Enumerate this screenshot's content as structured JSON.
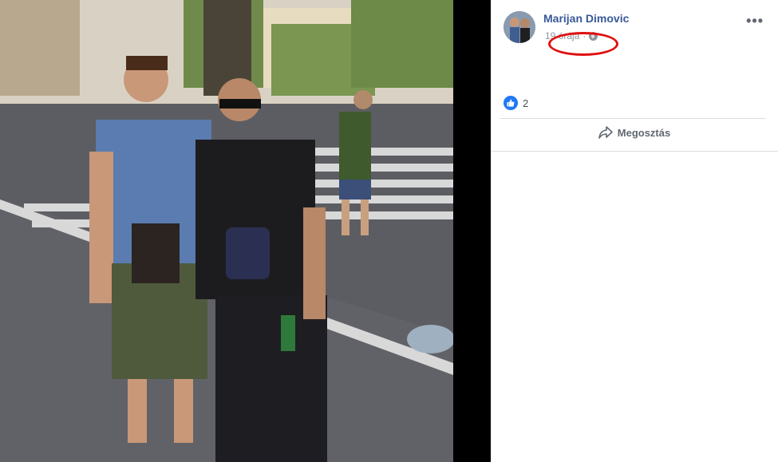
{
  "post": {
    "author": "Marijan Dimovic",
    "time": "19 órája",
    "separator": "·",
    "privacy_icon": "globe-icon",
    "more_label": "•••"
  },
  "reactions": {
    "icon": "like-icon",
    "count": "2"
  },
  "actions": {
    "share_label": "Megosztás",
    "share_icon": "share-arrow-icon"
  },
  "colors": {
    "author": "#385898",
    "like": "#2078f4",
    "annotation": "#e01010"
  }
}
